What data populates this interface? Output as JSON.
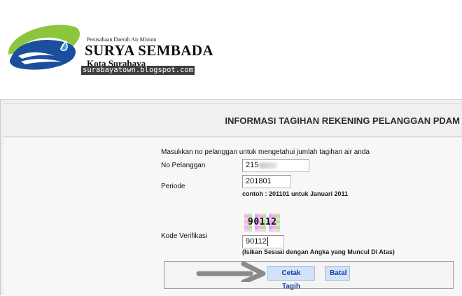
{
  "header": {
    "org_small": "Perusahaan Daerah Air Minum",
    "org_name": "SURYA SEMBADA",
    "org_city": "Kota Surabaya",
    "watermark": "surabayatown.blogspot.com"
  },
  "panel": {
    "title": "INFORMASI TAGIHAN REKENING PELANGGAN PDAM"
  },
  "form": {
    "instruction": "Masukkan no pelanggan untuk mengetahui jumlah tagihan air anda",
    "customer_number_label": "No Pelanggan",
    "customer_number_value": "215",
    "period_label": "Periode",
    "period_value": "201801",
    "period_hint": "contoh : 201101 untuk Januari 2011",
    "verification_label": "Kode Verifikasi",
    "captcha_text": "90112",
    "verification_value": "90112",
    "verification_hint": "(Isikan Sesuai dengan Angka yang Muncul Di Atas)"
  },
  "buttons": {
    "print_bill": "Cetak Tagih",
    "cancel": "Batal"
  },
  "colors": {
    "logo_blue": "#1b4f9c",
    "logo_green": "#8cc63f",
    "button_bg": "#d3e2f7",
    "button_text": "#1a3ea7",
    "arrow": "#8a8a8a"
  }
}
